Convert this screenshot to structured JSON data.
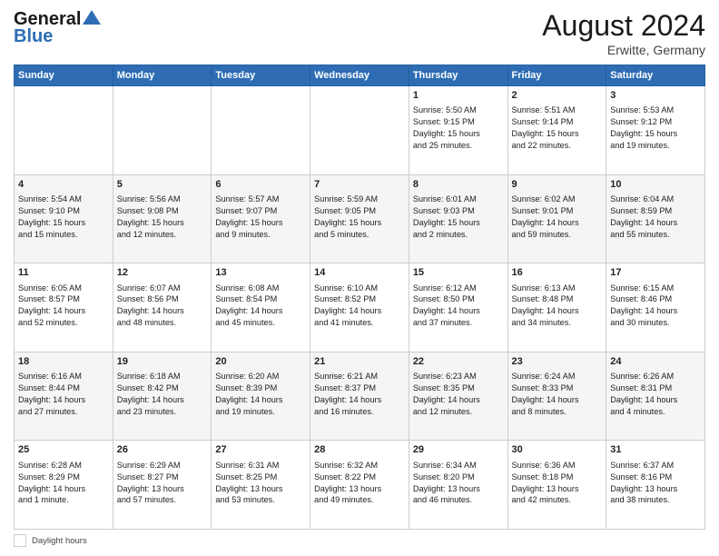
{
  "header": {
    "logo_general": "General",
    "logo_blue": "Blue",
    "month_title": "August 2024",
    "location": "Erwitte, Germany"
  },
  "footer": {
    "daylight_label": "Daylight hours"
  },
  "days_of_week": [
    "Sunday",
    "Monday",
    "Tuesday",
    "Wednesday",
    "Thursday",
    "Friday",
    "Saturday"
  ],
  "weeks": [
    [
      {
        "day": "",
        "info": ""
      },
      {
        "day": "",
        "info": ""
      },
      {
        "day": "",
        "info": ""
      },
      {
        "day": "",
        "info": ""
      },
      {
        "day": "1",
        "info": "Sunrise: 5:50 AM\nSunset: 9:15 PM\nDaylight: 15 hours\nand 25 minutes."
      },
      {
        "day": "2",
        "info": "Sunrise: 5:51 AM\nSunset: 9:14 PM\nDaylight: 15 hours\nand 22 minutes."
      },
      {
        "day": "3",
        "info": "Sunrise: 5:53 AM\nSunset: 9:12 PM\nDaylight: 15 hours\nand 19 minutes."
      }
    ],
    [
      {
        "day": "4",
        "info": "Sunrise: 5:54 AM\nSunset: 9:10 PM\nDaylight: 15 hours\nand 15 minutes."
      },
      {
        "day": "5",
        "info": "Sunrise: 5:56 AM\nSunset: 9:08 PM\nDaylight: 15 hours\nand 12 minutes."
      },
      {
        "day": "6",
        "info": "Sunrise: 5:57 AM\nSunset: 9:07 PM\nDaylight: 15 hours\nand 9 minutes."
      },
      {
        "day": "7",
        "info": "Sunrise: 5:59 AM\nSunset: 9:05 PM\nDaylight: 15 hours\nand 5 minutes."
      },
      {
        "day": "8",
        "info": "Sunrise: 6:01 AM\nSunset: 9:03 PM\nDaylight: 15 hours\nand 2 minutes."
      },
      {
        "day": "9",
        "info": "Sunrise: 6:02 AM\nSunset: 9:01 PM\nDaylight: 14 hours\nand 59 minutes."
      },
      {
        "day": "10",
        "info": "Sunrise: 6:04 AM\nSunset: 8:59 PM\nDaylight: 14 hours\nand 55 minutes."
      }
    ],
    [
      {
        "day": "11",
        "info": "Sunrise: 6:05 AM\nSunset: 8:57 PM\nDaylight: 14 hours\nand 52 minutes."
      },
      {
        "day": "12",
        "info": "Sunrise: 6:07 AM\nSunset: 8:56 PM\nDaylight: 14 hours\nand 48 minutes."
      },
      {
        "day": "13",
        "info": "Sunrise: 6:08 AM\nSunset: 8:54 PM\nDaylight: 14 hours\nand 45 minutes."
      },
      {
        "day": "14",
        "info": "Sunrise: 6:10 AM\nSunset: 8:52 PM\nDaylight: 14 hours\nand 41 minutes."
      },
      {
        "day": "15",
        "info": "Sunrise: 6:12 AM\nSunset: 8:50 PM\nDaylight: 14 hours\nand 37 minutes."
      },
      {
        "day": "16",
        "info": "Sunrise: 6:13 AM\nSunset: 8:48 PM\nDaylight: 14 hours\nand 34 minutes."
      },
      {
        "day": "17",
        "info": "Sunrise: 6:15 AM\nSunset: 8:46 PM\nDaylight: 14 hours\nand 30 minutes."
      }
    ],
    [
      {
        "day": "18",
        "info": "Sunrise: 6:16 AM\nSunset: 8:44 PM\nDaylight: 14 hours\nand 27 minutes."
      },
      {
        "day": "19",
        "info": "Sunrise: 6:18 AM\nSunset: 8:42 PM\nDaylight: 14 hours\nand 23 minutes."
      },
      {
        "day": "20",
        "info": "Sunrise: 6:20 AM\nSunset: 8:39 PM\nDaylight: 14 hours\nand 19 minutes."
      },
      {
        "day": "21",
        "info": "Sunrise: 6:21 AM\nSunset: 8:37 PM\nDaylight: 14 hours\nand 16 minutes."
      },
      {
        "day": "22",
        "info": "Sunrise: 6:23 AM\nSunset: 8:35 PM\nDaylight: 14 hours\nand 12 minutes."
      },
      {
        "day": "23",
        "info": "Sunrise: 6:24 AM\nSunset: 8:33 PM\nDaylight: 14 hours\nand 8 minutes."
      },
      {
        "day": "24",
        "info": "Sunrise: 6:26 AM\nSunset: 8:31 PM\nDaylight: 14 hours\nand 4 minutes."
      }
    ],
    [
      {
        "day": "25",
        "info": "Sunrise: 6:28 AM\nSunset: 8:29 PM\nDaylight: 14 hours\nand 1 minute."
      },
      {
        "day": "26",
        "info": "Sunrise: 6:29 AM\nSunset: 8:27 PM\nDaylight: 13 hours\nand 57 minutes."
      },
      {
        "day": "27",
        "info": "Sunrise: 6:31 AM\nSunset: 8:25 PM\nDaylight: 13 hours\nand 53 minutes."
      },
      {
        "day": "28",
        "info": "Sunrise: 6:32 AM\nSunset: 8:22 PM\nDaylight: 13 hours\nand 49 minutes."
      },
      {
        "day": "29",
        "info": "Sunrise: 6:34 AM\nSunset: 8:20 PM\nDaylight: 13 hours\nand 46 minutes."
      },
      {
        "day": "30",
        "info": "Sunrise: 6:36 AM\nSunset: 8:18 PM\nDaylight: 13 hours\nand 42 minutes."
      },
      {
        "day": "31",
        "info": "Sunrise: 6:37 AM\nSunset: 8:16 PM\nDaylight: 13 hours\nand 38 minutes."
      }
    ]
  ]
}
